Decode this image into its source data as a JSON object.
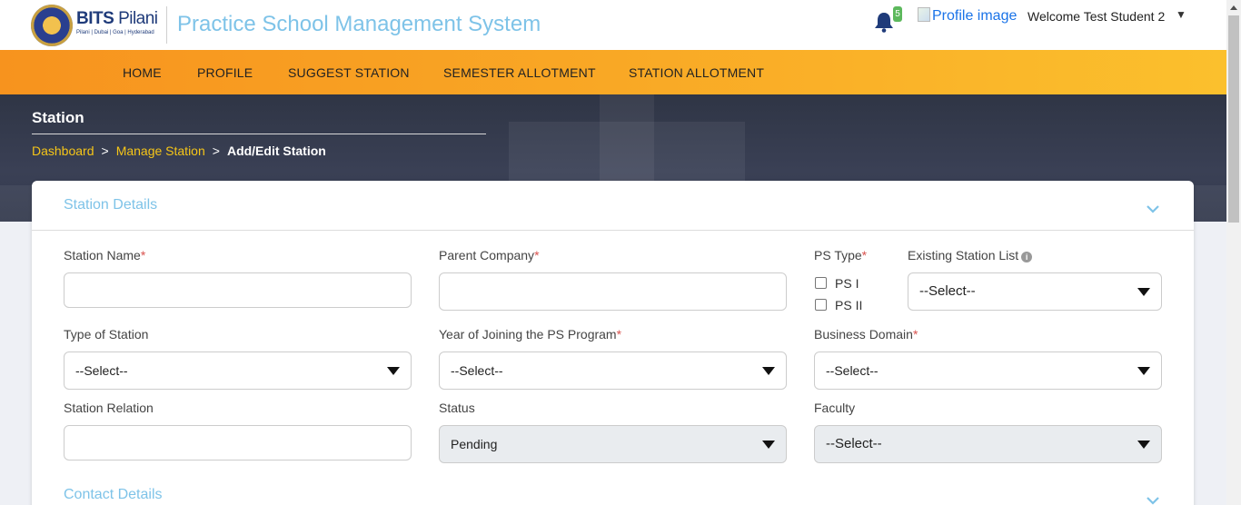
{
  "header": {
    "logo_text_bold": "BITS",
    "logo_text_light": "Pilani",
    "logo_sub": "Pilani | Dubai | Goa | Hyderabad",
    "app_title": "Practice School Management System",
    "notification_count": "5",
    "profile_image_alt": "Profile image",
    "welcome_text": "Welcome Test Student 2",
    "caret": "▼"
  },
  "nav": {
    "items": [
      {
        "label": "HOME"
      },
      {
        "label": "PROFILE"
      },
      {
        "label": "SUGGEST STATION"
      },
      {
        "label": "SEMESTER ALLOTMENT"
      },
      {
        "label": "STATION ALLOTMENT"
      }
    ]
  },
  "hero": {
    "title": "Station",
    "breadcrumb": {
      "dashboard": "Dashboard",
      "manage_station": "Manage Station",
      "current": "Add/Edit Station",
      "separator": ">"
    }
  },
  "form": {
    "section_title": "Station Details",
    "station_name_label": "Station Name",
    "parent_company_label": "Parent Company",
    "ps_type_label": "PS Type",
    "ps1_label": "PS I",
    "ps2_label": "PS II",
    "existing_station_label": "Existing Station List",
    "existing_station_value": "--Select--",
    "type_of_station_label": "Type of Station",
    "type_of_station_value": "--Select--",
    "year_joining_label": "Year of Joining the PS Program",
    "year_joining_value": "--Select--",
    "business_domain_label": "Business Domain",
    "business_domain_value": "--Select--",
    "station_relation_label": "Station Relation",
    "status_label": "Status",
    "status_value": "Pending",
    "faculty_label": "Faculty",
    "faculty_value": "--Select--",
    "required_mark": "*",
    "contact_section_title": "Contact Details"
  }
}
